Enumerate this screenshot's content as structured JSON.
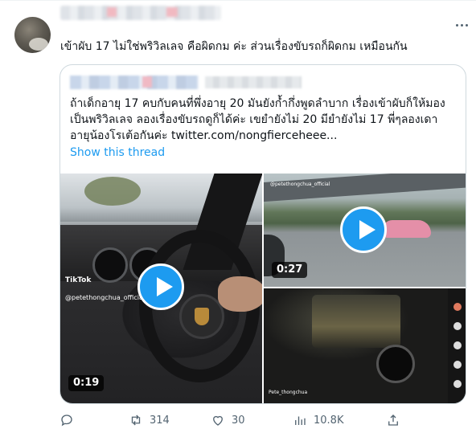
{
  "tweet": {
    "text": "เข้าผับ 17 ไม่ใช่พริวิลเลจ คือผิดกม ค่ะ ส่วนเรื่องขับรถก็ผิดกม เหมือนกัน"
  },
  "quote": {
    "lines": [
      "ถ้าเด็กอายุ 17 คบกับคนที่พึ่งอายุ 20 มันยังก้ำกึ่งพูดลำบาก เรื่องเข้าผับก็ให้มอง",
      "เป็นพริวิลเลจ ลองเรื่องขับรถดูก็ได้ค่ะ เขยำยังไม่ 20 มียำยังไม่ 17 พี่ๆลองเดา",
      "อายุน้องโรเต้อกันค่ะ  twitter.com/nongfierceheee..."
    ],
    "show_thread": "Show this thread",
    "media": {
      "left": {
        "duration": "0:19",
        "tiktok_logo": "TikTok",
        "tiktok_handle": "@petethongchua_official"
      },
      "top_right": {
        "duration": "0:27",
        "handle": "@petethongchua_official"
      },
      "bottom_right": {
        "user": "Pete_thongchua"
      }
    }
  },
  "actions": {
    "retweets": "314",
    "likes": "30",
    "views": "10.8K"
  },
  "colors": {
    "accent": "#1d9bf0",
    "muted": "#536471",
    "text": "#0f1419",
    "border": "#cfd9de"
  }
}
